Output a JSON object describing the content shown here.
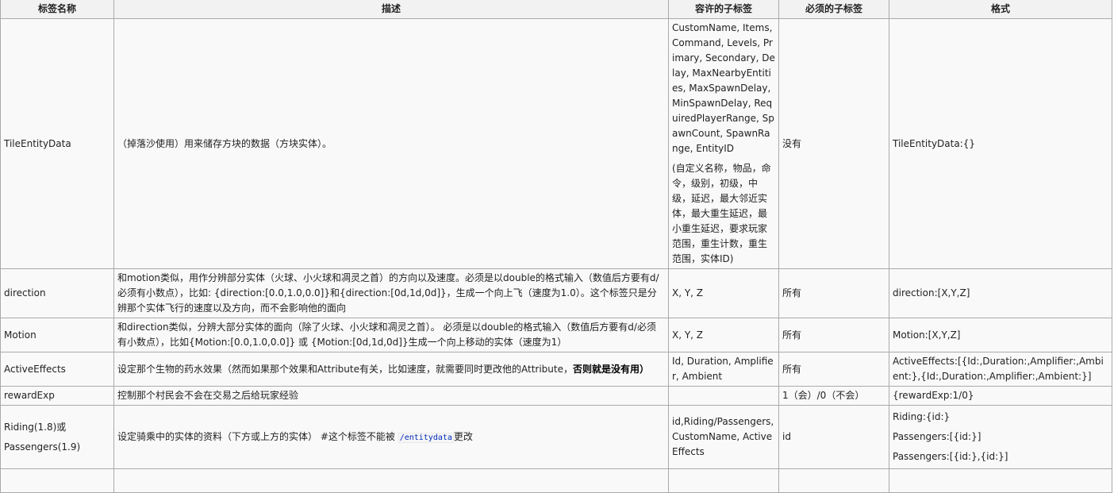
{
  "headers": {
    "name": "标签名称",
    "description": "描述",
    "allowed": "容许的子标签",
    "required": "必须的子标签",
    "format": "格式"
  },
  "rows": [
    {
      "name": "TileEntityData",
      "description": "（掉落沙使用）用来储存方块的数据（方块实体）。",
      "allowed": "CustomName, Items, Command, Levels, Primary, Secondary, Delay, MaxNearbyEntities, MaxSpawnDelay, MinSpawnDelay, RequiredPlayerRange, SpawnCount, SpawnRange, EntityID",
      "allowed_note": "(自定义名称，物品，命令，级别，初级，中级，延迟，最大邻近实体，最大重生延迟，最小重生延迟，要求玩家范围，重生计数，重生范围，实体ID)",
      "required": "没有",
      "format": "TileEntityData:{}"
    },
    {
      "name": "direction",
      "description": "和motion类似，用作分辨部分实体（火球、小火球和凋灵之首）的方向以及速度。必须是以double的格式输入（数值后方要有d/必须有小数点），比如: {direction:[0.0,1.0,0.0]}和{direction:[0d,1d,0d]}，生成一个向上飞（速度为1.0）。这个标签只是分辨那个实体飞行的速度以及方向，而不会影响他的面向",
      "allowed": "X, Y, Z",
      "required": "所有",
      "format": "direction:[X,Y,Z]"
    },
    {
      "name": "Motion",
      "description": "和direction类似，分辨大部分实体的面向（除了火球、小火球和凋灵之首）。 必须是以double的格式输入（数值后方要有d/必须有小数点），比如{Motion:[0.0,1.0,0.0]} 或 {Motion:[0d,1d,0d]}生成一个向上移动的实体（速度为1）",
      "allowed": "X, Y, Z",
      "required": "所有",
      "format": "Motion:[X,Y,Z]"
    },
    {
      "name": "ActiveEffects",
      "description": "设定那个生物的药水效果（然而如果那个效果和Attribute有关，比如速度，就需要同时更改他的Attribute，",
      "description_bold": "否则就是没有用）",
      "allowed": "Id, Duration, Amplifier, Ambient",
      "required": "所有",
      "format": "ActiveEffects:[{Id:,Duration:,Amplifier:,Ambient:},{Id:,Duration:,Amplifier:,Ambient:}]"
    },
    {
      "name": "rewardExp",
      "description": "控制那个村民会不会在交易之后给玩家经验",
      "allowed": "",
      "required": "1（会）/0（不会）",
      "format": "{rewardExp:1/0}"
    },
    {
      "name_line1": "Riding(1.8)或",
      "name_line2": "Passengers(1.9)",
      "description": "设定骑乘中的实体的资料（下方或上方的实体） #这个标签不能被 ",
      "description_code": "/entitydata",
      "description_tail": "更改",
      "allowed": "id,Riding/Passengers,CustomName, ActiveEffects",
      "required": "id",
      "format_lines": [
        "Riding:{id:}",
        "Passengers:[{id:}]",
        "Passengers:[{id:},{id:}]"
      ]
    }
  ]
}
